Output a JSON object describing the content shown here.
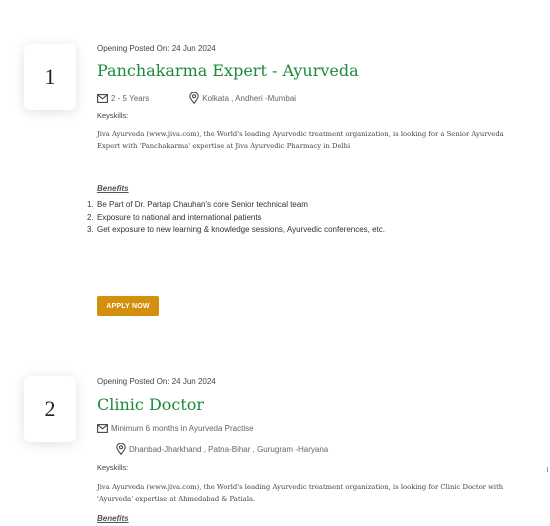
{
  "jobs": [
    {
      "number": "1",
      "posted": "Opening Posted On: 24 Jun 2024",
      "title": "Panchakarma Expert - Ayurveda",
      "experience": "2 - 5 Years",
      "location": "Kolkata , Andheri -Mumbai",
      "keyskills_label": "Keyskills:",
      "description_line1": "Jiva Ayurveda (www.jiva.com), the World's leading Ayurvedic treatment organization, is looking for a Senior Ayurveda",
      "description_line2": "Expert with 'Panchakarma' expertise at Jiva Ayurvedic Pharmacy in Delhi",
      "benefits_title": "Benefits",
      "benefits": [
        "Be Part of Dr. Partap Chauhan's core Senior technical team",
        "Exposure to national and international patients",
        "Get exposure to new learning & knowledge sessions, Ayurvedic conferences, etc."
      ],
      "apply_label": "APPLY NOW"
    },
    {
      "number": "2",
      "posted": "Opening Posted On: 24 Jun 2024",
      "title": "Clinic Doctor",
      "experience": "Minimum 6 months in Ayurveda Practise",
      "location": "Dhanbad-Jharkhand , Patna-Bihar , Gurugram -Haryana",
      "keyskills_label": "Keyskills:",
      "description_line1": "Jiva Ayurveda (www.jiva.com), the World's leading Ayurvedic treatment organization, is looking for Clinic Doctor with",
      "description_line2": "'Ayurveda' expertise at Ahmedabad & Patiala.",
      "benefits_title": "Benefits"
    }
  ],
  "colors": {
    "title_green": "#1b8a3a",
    "apply_button": "#d3900f"
  },
  "icons": {
    "experience": "envelope-icon",
    "location": "map-pin-icon"
  }
}
